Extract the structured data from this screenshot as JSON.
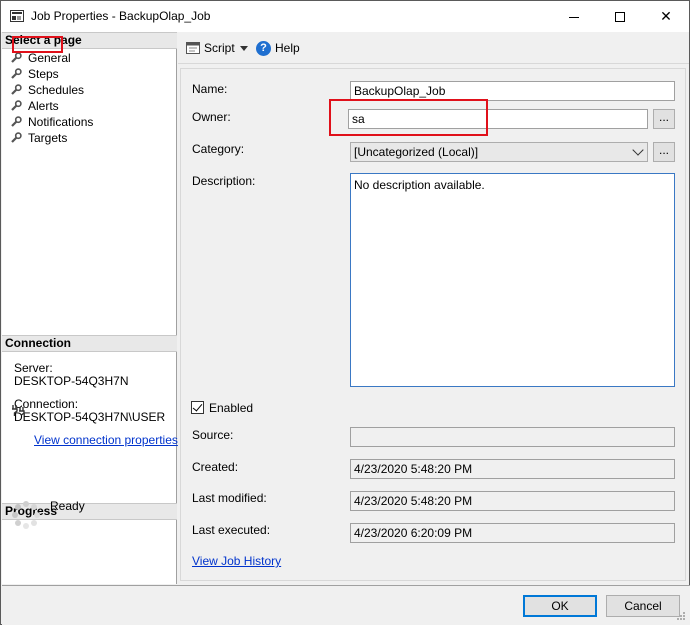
{
  "window": {
    "title": "Job Properties - BackupOlap_Job",
    "min_glyph": "",
    "close_glyph": "✕"
  },
  "left_pane": {
    "select_page_header": "Select a page",
    "pages": [
      {
        "label": "General"
      },
      {
        "label": "Steps"
      },
      {
        "label": "Schedules"
      },
      {
        "label": "Alerts"
      },
      {
        "label": "Notifications"
      },
      {
        "label": "Targets"
      }
    ],
    "connection_header": "Connection",
    "server_label": "Server:",
    "server_value": "DESKTOP-54Q3H7N",
    "connection_label": "Connection:",
    "connection_value": "DESKTOP-54Q3H7N\\USER",
    "view_connection_link": "View connection properties",
    "progress_header": "Progress",
    "progress_status": "Ready"
  },
  "toolbar": {
    "script_label": "Script",
    "help_label": "Help",
    "help_glyph": "?"
  },
  "form": {
    "name_label": "Name:",
    "name_value": "BackupOlap_Job",
    "owner_label": "Owner:",
    "owner_value": "sa",
    "category_label": "Category:",
    "category_value": "[Uncategorized (Local)]",
    "description_label": "Description:",
    "description_value": "No description available.",
    "enabled_label": "Enabled",
    "enabled_checked": true,
    "source_label": "Source:",
    "source_value": "",
    "created_label": "Created:",
    "created_value": "4/23/2020 5:48:20 PM",
    "last_modified_label": "Last modified:",
    "last_modified_value": "4/23/2020 5:48:20 PM",
    "last_executed_label": "Last executed:",
    "last_executed_value": "4/23/2020 6:20:09 PM",
    "browse_glyph": "...",
    "view_history_link": "View Job History"
  },
  "buttons": {
    "ok_label": "OK",
    "cancel_label": "Cancel"
  },
  "colors": {
    "highlight": "#e0101a",
    "link": "#0033cc",
    "accent": "#0078d7"
  }
}
